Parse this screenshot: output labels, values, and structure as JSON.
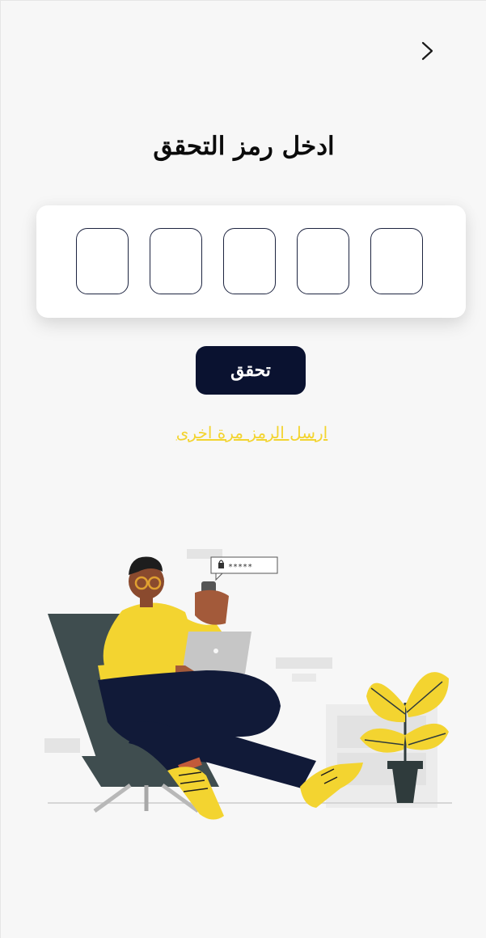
{
  "header": {
    "back_icon": "chevron-right-icon"
  },
  "page": {
    "title": "ادخل رمز التحقق"
  },
  "otp": {
    "digits": [
      "",
      "",
      "",
      "",
      ""
    ]
  },
  "actions": {
    "verify_label": "تحقق",
    "resend_label": "ارسل الرمز مرة اخرى"
  },
  "illustration": {
    "password_mask": "*****"
  },
  "colors": {
    "background": "#f7f7f7",
    "primary": "#0a1230",
    "accent_yellow": "#f3d430",
    "card": "#ffffff"
  }
}
